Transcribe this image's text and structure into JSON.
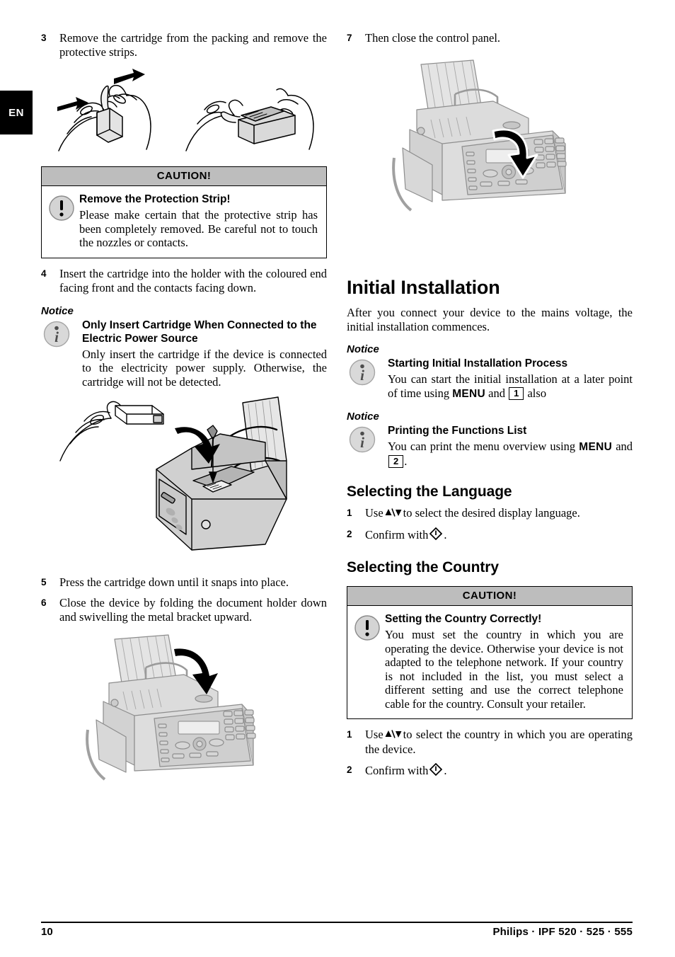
{
  "page": {
    "language_tab": "EN",
    "footer_page_number": "10",
    "footer_brand": "Philips · IPF 520 · 525 · 555"
  },
  "left_column": {
    "step3": {
      "number": "3",
      "text": "Remove the cartridge from the packing and remove the protective strips."
    },
    "figure_cartridge_unpack": "cartridge-unpacking-illustration",
    "caution_protection_strip": {
      "header": "CAUTION!",
      "icon": "exclamation-circle-icon",
      "title": "Remove the Protection Strip!",
      "text": "Please make certain that the protective strip has been completely removed. Be careful not to touch the nozzles or contacts."
    },
    "step4": {
      "number": "4",
      "text": "Insert the cartridge into the holder with the coloured end facing front and the contacts facing down."
    },
    "notice_insert_cartridge": {
      "label": "Notice",
      "icon": "info-circle-icon",
      "title": "Only Insert Cartridge When Connected to the Electric Power Source",
      "text": "Only insert the cartridge if the device is connected to the electricity power supply. Otherwise, the cartridge will not be detected."
    },
    "figure_insert_cartridge": "insert-cartridge-into-device-illustration",
    "step5": {
      "number": "5",
      "text": "Press the cartridge down until it snaps into place."
    },
    "step6": {
      "number": "6",
      "text": "Close the device by folding the document holder down and swivelling the metal bracket upward."
    },
    "figure_close_device": "close-device-illustration"
  },
  "right_column": {
    "step7": {
      "number": "7",
      "text": "Then close the control panel."
    },
    "figure_close_control_panel": "close-control-panel-illustration",
    "heading_initial_installation": "Initial Installation",
    "intro_paragraph": "After you connect your device to the mains voltage, the initial installation commences.",
    "notice_starting_process": {
      "label": "Notice",
      "icon": "info-circle-icon",
      "title": "Starting Initial Installation Process",
      "text_part1": "You can start the initial installation at a later point of time using",
      "menu_key": "MENU",
      "and_word": "and",
      "number_key": "1",
      "text_part2": "also"
    },
    "notice_printing_functions": {
      "label": "Notice",
      "icon": "info-circle-icon",
      "title": "Printing the Functions List",
      "text_part1": "You can print the menu overview using",
      "menu_key": "MENU",
      "and_word": "and",
      "number_key": "2",
      "text_part2": "."
    },
    "heading_selecting_language": "Selecting the Language",
    "language_step1": {
      "number": "1",
      "text_before": "Use",
      "arrows_glyph": "up-down-arrows-icon",
      "text_after": "to select the desired display language."
    },
    "language_step2": {
      "number": "2",
      "text_before": "Confirm with",
      "ok_glyph": "ok-diamond-icon",
      "text_after": "."
    },
    "heading_selecting_country": "Selecting the Country",
    "caution_country": {
      "header": "CAUTION!",
      "icon": "exclamation-circle-icon",
      "title": "Setting the Country Correctly!",
      "text": "You must set the country in which you are operating the device. Otherwise your device is not adapted to the telephone network. If your country is not included in the list, you must select a different setting and use the correct telephone cable for the country. Consult your retailer."
    },
    "country_step1": {
      "number": "1",
      "text_before": "Use",
      "arrows_glyph": "up-down-arrows-icon",
      "text_after": "to select the country in which you are operating the device."
    },
    "country_step2": {
      "number": "2",
      "text_before": "Confirm with",
      "ok_glyph": "ok-diamond-icon",
      "text_after": "."
    }
  }
}
